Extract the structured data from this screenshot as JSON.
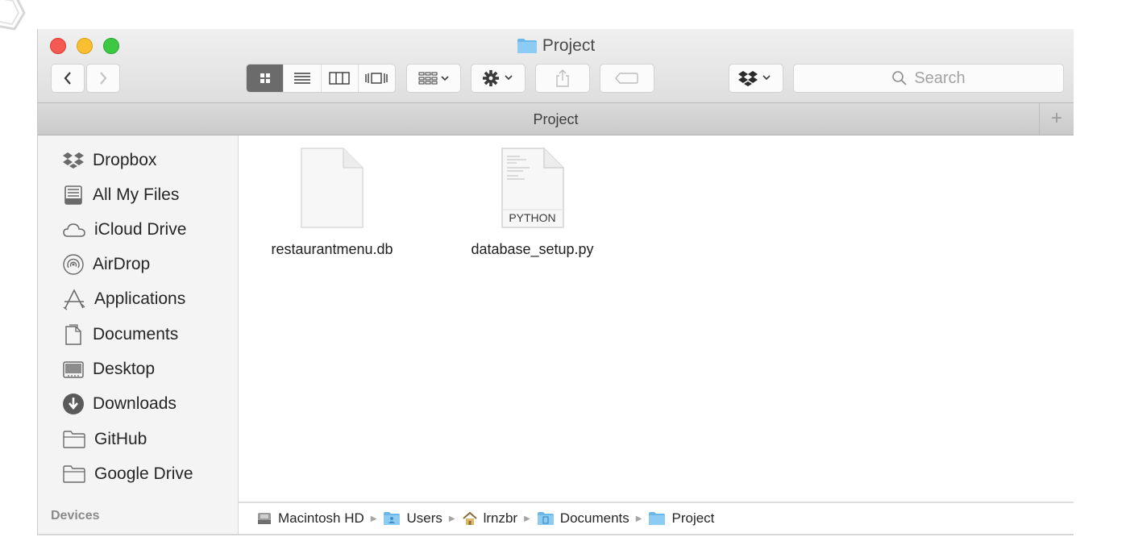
{
  "window": {
    "title": "Project"
  },
  "toolbar": {
    "back_icon": "chevron-left-icon",
    "forward_icon": "chevron-right-icon",
    "view_modes": [
      "icon-view-icon",
      "list-view-icon",
      "column-view-icon",
      "cover-flow-icon"
    ],
    "active_view": "icon",
    "arrange_icon": "arrange-icon",
    "action_icon": "gear-icon",
    "share_icon": "share-icon",
    "tags_icon": "tag-icon",
    "dropbox_icon": "dropbox-icon",
    "search_placeholder": "Search"
  },
  "tab": {
    "label": "Project",
    "add_icon": "plus-icon"
  },
  "sidebar": {
    "items": [
      {
        "label": "Dropbox",
        "icon": "dropbox-icon"
      },
      {
        "label": "All My Files",
        "icon": "all-files-icon"
      },
      {
        "label": "iCloud Drive",
        "icon": "cloud-icon"
      },
      {
        "label": "AirDrop",
        "icon": "airdrop-icon"
      },
      {
        "label": "Applications",
        "icon": "applications-icon"
      },
      {
        "label": "Documents",
        "icon": "documents-icon"
      },
      {
        "label": "Desktop",
        "icon": "desktop-icon"
      },
      {
        "label": "Downloads",
        "icon": "downloads-icon"
      },
      {
        "label": "GitHub",
        "icon": "folder-icon"
      },
      {
        "label": "Google Drive",
        "icon": "folder-icon"
      }
    ],
    "devices_heading": "Devices"
  },
  "files": [
    {
      "name": "restaurantmenu.db",
      "icon": "blank-document-icon"
    },
    {
      "name": "database_setup.py",
      "icon": "python-document-icon",
      "badge": "PYTHON"
    }
  ],
  "pathbar": {
    "crumbs": [
      {
        "label": "Macintosh HD",
        "icon": "hard-drive-icon"
      },
      {
        "label": "Users",
        "icon": "users-folder-icon"
      },
      {
        "label": "lrnzbr",
        "icon": "home-icon"
      },
      {
        "label": "Documents",
        "icon": "documents-folder-icon"
      },
      {
        "label": "Project",
        "icon": "folder-icon"
      }
    ]
  },
  "colors": {
    "close": "#f45952",
    "minimize": "#f9be31",
    "maximize": "#3cc843",
    "folder_blue": "#6ab7ea",
    "active_segment": "#6b6b6b"
  }
}
